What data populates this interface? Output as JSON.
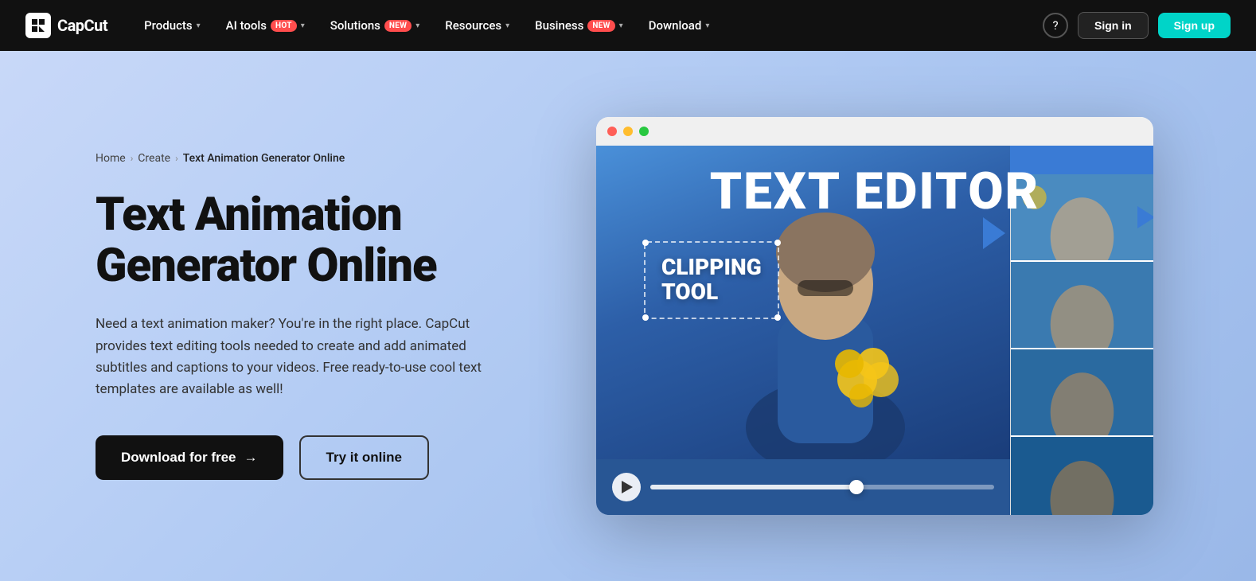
{
  "navbar": {
    "logo_text": "CapCut",
    "nav_items": [
      {
        "label": "Products",
        "has_chevron": true,
        "badge": null
      },
      {
        "label": "AI tools",
        "has_chevron": true,
        "badge": "Hot",
        "badge_type": "hot"
      },
      {
        "label": "Solutions",
        "has_chevron": true,
        "badge": "New",
        "badge_type": "new"
      },
      {
        "label": "Resources",
        "has_chevron": true,
        "badge": null
      },
      {
        "label": "Business",
        "has_chevron": true,
        "badge": "New",
        "badge_type": "new"
      },
      {
        "label": "Download",
        "has_chevron": true,
        "badge": null
      }
    ],
    "signin_label": "Sign in",
    "signup_label": "Sign up"
  },
  "breadcrumb": {
    "home": "Home",
    "create": "Create",
    "current": "Text Animation Generator Online"
  },
  "hero": {
    "title": "Text Animation Generator Online",
    "description": "Need a text animation maker? You're in the right place. CapCut provides text editing tools needed to create and add animated subtitles and captions to your videos. Free ready-to-use cool text templates are available as well!",
    "download_btn": "Download for free",
    "try_btn": "Try it online",
    "arrow": "→"
  },
  "editor": {
    "window_title": "TEXT EDITOR",
    "clipping_label": "CLIPPING\nTOOL",
    "dots": [
      "red",
      "yellow",
      "green"
    ]
  }
}
